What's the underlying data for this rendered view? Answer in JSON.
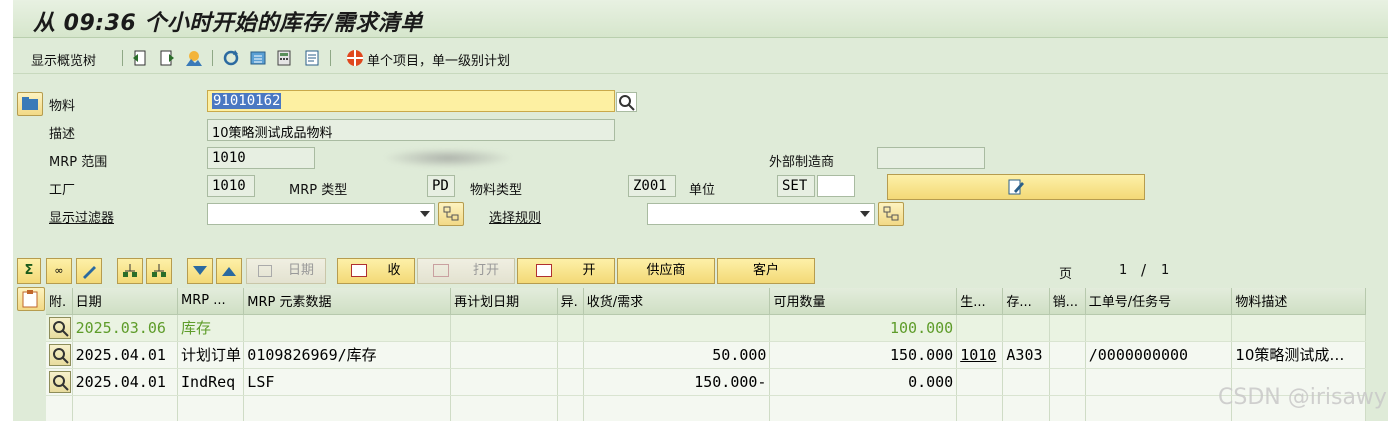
{
  "title": "从 09:36 个小时开始的库存/需求清单",
  "toolbar": {
    "overview_tree": "显示概览树",
    "single_item_planning": "单个项目，单一级别计划"
  },
  "header": {
    "material_label": "物料",
    "material_value": "91010162",
    "desc_label": "描述",
    "desc_value": "10策略测试成品物料",
    "mrp_area_label": "MRP 范围",
    "mrp_area_value": "1010",
    "ext_manufacturer_label": "外部制造商",
    "ext_manufacturer_value": "",
    "plant_label": "工厂",
    "plant_value": "1010",
    "mrp_type_label": "MRP 类型",
    "mrp_type_value": "PD",
    "material_type_label": "物料类型",
    "material_type_value": "Z001",
    "unit_label": "单位",
    "unit_value": "SET",
    "filter_label": "显示过滤器",
    "selection_rule_label": "选择规则"
  },
  "grid_toolbar": {
    "date_btn": "日期",
    "receive_btn": "收",
    "open_btn": "打开",
    "open2_btn": "开",
    "vendor_btn": "供应商",
    "customer_btn": "客户",
    "page_label": "页",
    "page_current": "1",
    "page_sep": "/",
    "page_total": "1"
  },
  "table": {
    "columns": [
      "附.",
      "日期",
      "MRP ...",
      "MRP 元素数据",
      "再计划日期",
      "异.",
      "收货/需求",
      "可用数量",
      "生...",
      "存...",
      "销...",
      "工单号/任务号",
      "物料描述"
    ],
    "rows": [
      [
        "",
        "2025.03.06",
        "库存",
        "",
        "",
        "",
        "",
        "100.000",
        "",
        "",
        "",
        "",
        ""
      ],
      [
        "",
        "2025.04.01",
        "计划订单",
        "0109826969/库存",
        "",
        "",
        "50.000",
        "150.000",
        "1010",
        "A303",
        "",
        "/0000000000",
        "10策略测试成…"
      ],
      [
        "",
        "2025.04.01",
        "IndReq",
        "LSF",
        "",
        "",
        "150.000-",
        "0.000",
        "",
        "",
        "",
        "",
        ""
      ]
    ]
  },
  "watermark": "CSDN @irisawy"
}
